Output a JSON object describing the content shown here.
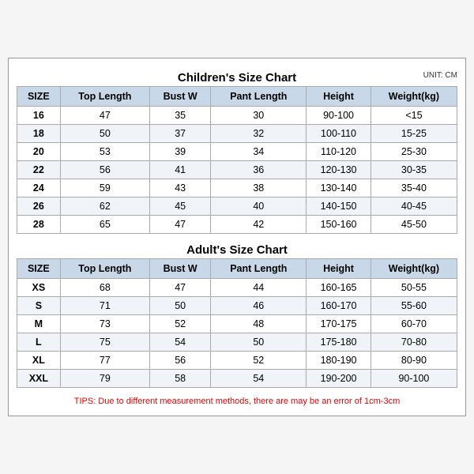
{
  "children_title": "Children's Size Chart",
  "adult_title": "Adult's Size Chart",
  "unit": "UNIT: CM",
  "tips": "TIPS: Due to different measurement methods, there are may be an error of 1cm-3cm",
  "headers": [
    "SIZE",
    "Top Length",
    "Bust W",
    "Pant Length",
    "Height",
    "Weight(kg)"
  ],
  "children_rows": [
    [
      "16",
      "47",
      "35",
      "30",
      "90-100",
      "<15"
    ],
    [
      "18",
      "50",
      "37",
      "32",
      "100-110",
      "15-25"
    ],
    [
      "20",
      "53",
      "39",
      "34",
      "110-120",
      "25-30"
    ],
    [
      "22",
      "56",
      "41",
      "36",
      "120-130",
      "30-35"
    ],
    [
      "24",
      "59",
      "43",
      "38",
      "130-140",
      "35-40"
    ],
    [
      "26",
      "62",
      "45",
      "40",
      "140-150",
      "40-45"
    ],
    [
      "28",
      "65",
      "47",
      "42",
      "150-160",
      "45-50"
    ]
  ],
  "adult_rows": [
    [
      "XS",
      "68",
      "47",
      "44",
      "160-165",
      "50-55"
    ],
    [
      "S",
      "71",
      "50",
      "46",
      "160-170",
      "55-60"
    ],
    [
      "M",
      "73",
      "52",
      "48",
      "170-175",
      "60-70"
    ],
    [
      "L",
      "75",
      "54",
      "50",
      "175-180",
      "70-80"
    ],
    [
      "XL",
      "77",
      "56",
      "52",
      "180-190",
      "80-90"
    ],
    [
      "XXL",
      "79",
      "58",
      "54",
      "190-200",
      "90-100"
    ]
  ]
}
